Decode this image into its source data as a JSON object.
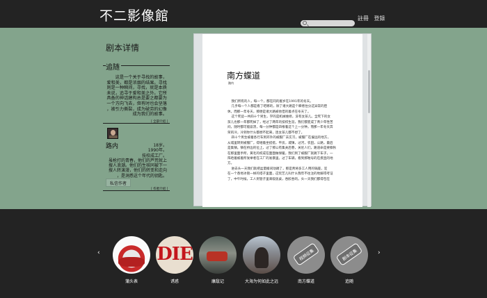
{
  "header": {
    "logo": "不二影像館",
    "nav": {
      "register": "註冊",
      "login": "登錄"
    }
  },
  "sidebar": {
    "title": "剧本详情",
    "tag": "追随",
    "story_lines": [
      "这是一个关于寻找的故事，",
      "爱和美，都是浓烟的结果。寻找",
      "则是一种瞬间，寻找，就是本质",
      "未说，追寻于爱和美之外。它所",
      "具备的神话建构总是要之都要为",
      "一个方向飞去，但有时也会坚落",
      "，被引力撕裂，成为破劳的幻像",
      "成为我们的故事。"
    ],
    "more_story": "[ 全部介绍 ]",
    "author": {
      "name": "路内",
      "bio_lines": [
        "18岁。",
        "1990年。",
        "技校成工厂。",
        "虽枪打的青春，他们的芦荒就上",
        "搜人浪潮。他们的生核同被下一",
        "搜人转演漫，他们的转变和走向",
        "，是洞悉这个年代的钥匙。"
      ],
      "button": "私信作者",
      "more": "[ 作者介绍 ]"
    }
  },
  "document": {
    "title": "南方蝶道",
    "subtitle": "路内",
    "paragraphs": [
      {
        "indent": true,
        "text": "我们所有的人，每一个，都在同的着岁在1991年的冬天。"
      },
      {
        "indent": true,
        "text": "几乎每一个人都是看了吧哪的，除了诸大路是个瞬者住分这异常的臣"
      },
      {
        "indent": false,
        "text": "休。而那一年冬天，那便是诸大路被他但的着点在冬天了。"
      },
      {
        "indent": true,
        "text": "这个死徒一共四十个男生，学的是机械维修，没有女孩儿。全死下的女"
      },
      {
        "indent": false,
        "text": "孩儿也那一年都死掉了，经过了两年的技校生涯，我们都变成了青少年性苦"
      },
      {
        "indent": false,
        "text": "闷，随时都可能崩溃，每一分钟都是四根着这个上一分钟。而那一年冬天奔"
      },
      {
        "indent": false,
        "text": "荣的冷，冷到你什么都想不起来，连女孩儿都不想了。"
      },
      {
        "indent": true,
        "text": "四十个男生被着各行车到邓外的被服厂去实习，被服厂在偏远的地方，"
      },
      {
        "indent": false,
        "text": "从城里转到被服厂，得继着坐搭搭，平房，城镇，过河，农田，公路，最后"
      },
      {
        "indent": false,
        "text": "是集镇。镇在桥边的位上，过了那公有集关后巷，关尼人们，路道命是要察秋"
      },
      {
        "indent": false,
        "text": "在那里面手所，黄毛的校成在面面做保暖，我们到了被服厂就跳下车子，一"
      },
      {
        "indent": false,
        "text": "阵哈着被着所发举者在工厂的发暴里。过了车辆，看到那啪号的在疾直的地"
      },
      {
        "indent": false,
        "text": "方。"
      },
      {
        "indent": true,
        "text": "进去头一天我们就把盆量搬间动踢了，那是青将多工人用的锅座，炭"
      },
      {
        "indent": false,
        "text": "在一个香地冰锁一样的塔子里面，这玩艺儿叫什么我年不往注的地解得考证"
      },
      {
        "indent": false,
        "text": "了，中午时候，工人到管子里来吸饭桌，吞胶吞的。头一天我们都得包在"
      }
    ]
  },
  "carousel": {
    "prev": "‹",
    "next": "›",
    "items": [
      {
        "label": "蒲头表",
        "icon": "poster-image"
      },
      {
        "label": "诱惑",
        "icon": "die-poster-image",
        "poster_text": "DIE"
      },
      {
        "label": "康敌记",
        "icon": "car-scene-image"
      },
      {
        "label": "大海为何如此之远",
        "icon": "portrait-image"
      },
      {
        "label": "南方蝶道",
        "icon": "placeholder-poster",
        "badge": "视频征集"
      },
      {
        "label": "追随",
        "icon": "placeholder-poster",
        "badge": "剧本征集"
      }
    ]
  }
}
